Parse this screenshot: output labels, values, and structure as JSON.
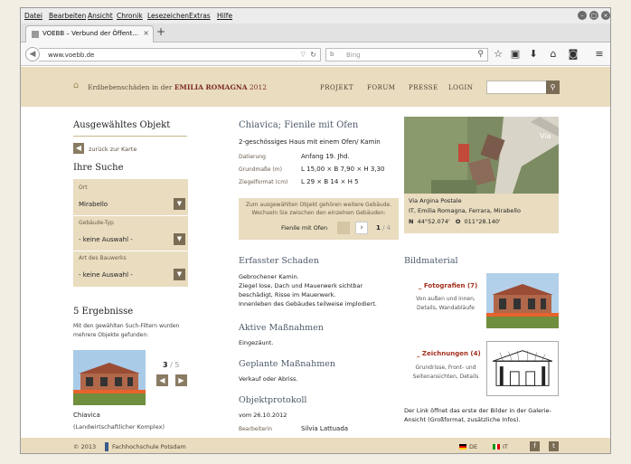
{
  "menu": [
    "Datei",
    "Bearbeiten",
    "Ansicht",
    "Chronik",
    "Lesezeichen",
    "Extras",
    "Hilfe"
  ],
  "tab": {
    "title": "VOEBB – Verbund der Öffent...",
    "close": "×",
    "new": "+"
  },
  "nav": {
    "url": "www.voebb.de",
    "search_placeholder": "Bing",
    "search_engine": "b"
  },
  "site": {
    "title_prefix": "Erdbebenschäden in der ",
    "title_bold": "EMILIA ROMAGNA",
    "title_year": " 2012",
    "menu": [
      "PROJEKT",
      "FORUM",
      "PRESSE",
      "LOGIN"
    ]
  },
  "left": {
    "title": "Ausgewähltes Objekt",
    "back": "zurück zur Karte",
    "search_title": "Ihre Suche",
    "filters": [
      {
        "label": "Ort",
        "value": "Mirabello"
      },
      {
        "label": "Gebäude-Typ",
        "value": "- keine Auswahl -"
      },
      {
        "label": "Art des Bauwerks",
        "value": "- keine Auswahl -"
      }
    ],
    "results_title": "5 Ergebnisse",
    "results_text": "Mit den gewählten Such-Filtern wurden mehrere Objekte gefunden:",
    "page_current": "3",
    "page_total": " / 5",
    "result_name": "Chiavica",
    "result_sub": "(Landwirtschaftlicher Komplex)"
  },
  "object": {
    "title": "Chiavica; Fienile mit Ofen",
    "subtitle": "2-geschössiges Haus mit einem Ofen/ Kamin",
    "details": [
      {
        "label": "Datierung",
        "value": "Anfang 19. Jhd."
      },
      {
        "label": "Grundmaße (m)",
        "value": "L 15,00 × B 7,90 × H 3,30"
      },
      {
        "label": "Ziegelformat (cm)",
        "value": "L 29 × B 14 × H 5"
      }
    ],
    "group_text": "Zum ausgewählten Objekt gehören weitere Gebäude. Wechseln Sie zwischen den einzelnen Gebäuden:",
    "group_label": "Fienile mit Ofen",
    "group_page": "1",
    "group_total": " / 4",
    "address1": "Via Argina Postale",
    "address2": "IT, Emilia Romagna, Ferrara, Mirabello",
    "coords_n_label": "N",
    "coords_n": "44°52.074'",
    "coords_o_label": "O",
    "coords_o": "011°28.140'",
    "map_label": "Via"
  },
  "damage": {
    "title": "Erfasster Schaden",
    "text": [
      "Gebrochener Kamin.",
      "Ziegel lose, Dach und Mauerwerk sichtbar",
      "beschädigt, Risse im Mauerwerk.",
      "Innenleben des Gebäudes teilweise implodiert."
    ]
  },
  "measures": {
    "title": "Aktive Maßnahmen",
    "text": "Eingezäunt."
  },
  "planned": {
    "title": "Geplante Maßnahmen",
    "text": "Verkauf oder Abriss."
  },
  "protocol": {
    "title": "Objektprotokoll",
    "date": "vom 26.10.2012",
    "label": "Bearbeiterin",
    "value": "Silvia Lattuada"
  },
  "media": {
    "title": "Bildmaterial",
    "photos_label": "_ Fotografien (7)",
    "photos_text": "Von außen und innen, Details, Wandabläufe",
    "drawings_label": "_ Zeichnungen (4)",
    "drawings_text": "Grundrisse, Front- und Seitenansichten, Details",
    "note": "Der Link öffnet das erste der Bilder in der Galerie-Ansicht (Großformat, zusätzliche Infos)."
  },
  "footer": {
    "copyright": "© 2013",
    "org": "Fachhochschule Potsdam",
    "lang_de": "DE",
    "lang_it": "IT",
    "fb": "f",
    "tw": "t"
  }
}
